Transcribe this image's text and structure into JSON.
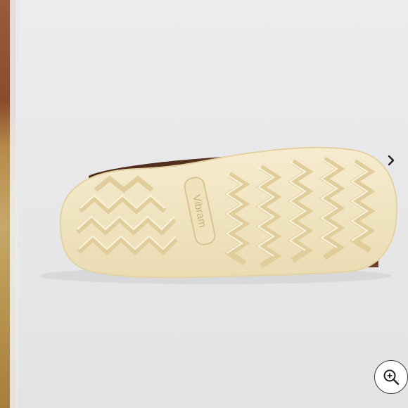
{
  "viewer": {
    "sole_logo_text": "Vibram",
    "icons": {
      "next": "chevron-right-icon",
      "zoom": "zoom-in-icon"
    },
    "colors": {
      "background": "#e9e9eb",
      "sole": "#f2e6c4",
      "leather": "#5a3322",
      "icon": "#222222"
    }
  }
}
